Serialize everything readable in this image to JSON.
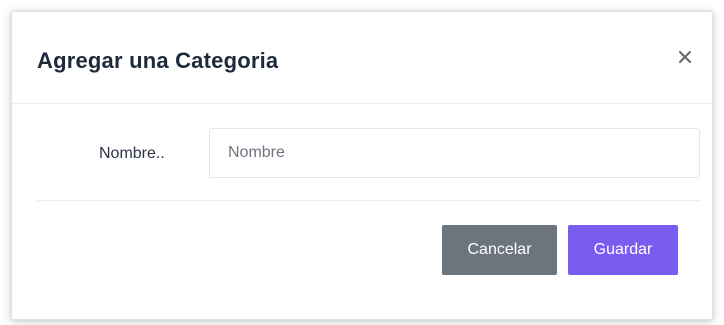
{
  "dialog": {
    "title": "Agregar una Categoria",
    "close_icon": "close-icon"
  },
  "form": {
    "name_label": "Nombre..",
    "name_placeholder": "Nombre",
    "name_value": ""
  },
  "footer": {
    "cancel_label": "Cancelar",
    "save_label": "Guardar"
  },
  "colors": {
    "cancel_button": "#6c757d",
    "save_button": "#7b5cf0",
    "title_text": "#1e2a3b"
  }
}
